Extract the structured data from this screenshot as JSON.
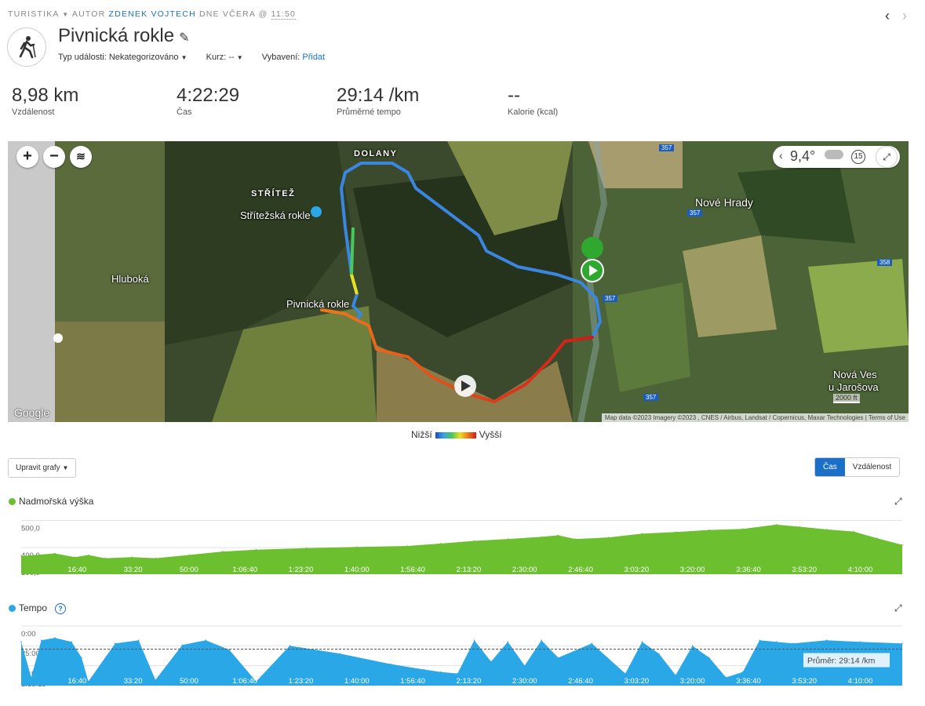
{
  "header": {
    "category": "TURISTIKA",
    "dropdown_glyph": "▼",
    "author_prefix": "AUTOR",
    "author": "ZDENEK VOJTECH",
    "date_prefix": "DNE VČERA @",
    "time": "11:50",
    "prev_arrow": "‹",
    "next_arrow": "›"
  },
  "activity": {
    "icon": "hiker-icon",
    "title": "Pivnická rokle",
    "edit_icon": "pencil-icon",
    "event_type_label": "Typ události:",
    "event_type_value": "Nekategorizováno",
    "course_label": "Kurz:",
    "course_value": "--",
    "gear_label": "Vybavení:",
    "gear_link": "Přidat"
  },
  "stats": [
    {
      "value": "8,98 km",
      "label": "Vzdálenost"
    },
    {
      "value": "4:22:29",
      "label": "Čas"
    },
    {
      "value": "29:14 /km",
      "label": "Průměrné tempo"
    },
    {
      "value": "--",
      "label": "Kalorie (kcal)"
    }
  ],
  "map": {
    "zoom_in": "+",
    "zoom_out": "−",
    "temperature": "9,4°",
    "wind_value": "15",
    "places": {
      "dolany": "DOLANY",
      "stritez": "STŘÍTEŽ",
      "stritezska": "Střítežská rokle",
      "nove_hrady": "Nové Hrady",
      "hluboka": "Hluboká",
      "pivnicka": "Pivnická rokle",
      "nova_ves": "Nová Ves",
      "nova_ves2": "u Jarošova"
    },
    "road_numbers": [
      "357",
      "357",
      "358",
      "357",
      "357"
    ],
    "scale": "2000 ft",
    "google": "Google",
    "attribution": "Map data ©2023 Imagery ©2023 , CNES / Airbus, Landsat / Copernicus, Maxar Technologies",
    "terms": "Terms of Use",
    "legend_low": "Nižší",
    "legend_high": "Vyšší",
    "colors": {
      "low": "#2446c8",
      "high": "#d01a1a",
      "start_marker": "#2fa82f"
    }
  },
  "controls": {
    "edit_charts": "Upravit grafy",
    "toggle_time": "Čas",
    "toggle_distance": "Vzdálenost",
    "toggle_active": "Čas"
  },
  "chart_data": [
    {
      "type": "area",
      "title": "Nadmořská výška",
      "color": "#6cbf2e",
      "y_ticks": [
        "500,0",
        "400,0",
        "300,0"
      ],
      "ylim": [
        300,
        500
      ],
      "x_ticks": [
        "16:40",
        "33:20",
        "50:00",
        "1:06:40",
        "1:23:20",
        "1:40:00",
        "1:56:40",
        "2:13:20",
        "2:30:00",
        "2:46:40",
        "3:03:20",
        "3:20:00",
        "3:36:40",
        "3:53:20",
        "4:10:00"
      ],
      "x_minutes": [
        0,
        10,
        16,
        20,
        25,
        33,
        40,
        50,
        60,
        70,
        85,
        100,
        115,
        125,
        135,
        145,
        155,
        160,
        165,
        175,
        185,
        195,
        205,
        215,
        225,
        232,
        240,
        248,
        255,
        262.5
      ],
      "values": [
        368,
        378,
        364,
        372,
        360,
        364,
        360,
        372,
        385,
        392,
        398,
        402,
        406,
        415,
        425,
        432,
        440,
        446,
        432,
        438,
        452,
        458,
        466,
        470,
        486,
        478,
        468,
        460,
        435,
        410
      ]
    },
    {
      "type": "area",
      "title": "Tempo",
      "color": "#2aa7e6",
      "y_ticks": [
        "0:00",
        "25:00",
        "50:00",
        "1:15:15"
      ],
      "ylim_minutes_per_km": [
        0,
        75.25
      ],
      "inverted": true,
      "average_label": "Průměr: 29:14 /km",
      "average_minutes_per_km": 29.23,
      "x_ticks": [
        "16:40",
        "33:20",
        "50:00",
        "1:06:40",
        "1:23:20",
        "1:40:00",
        "1:56:40",
        "2:13:20",
        "2:30:00",
        "2:46:40",
        "3:03:20",
        "3:20:00",
        "3:36:40",
        "3:53:20",
        "4:10:00"
      ],
      "x_minutes": [
        0,
        3,
        6,
        10,
        15,
        18,
        20,
        28,
        35,
        40,
        48,
        55,
        62,
        70,
        80,
        95,
        110,
        120,
        125,
        130,
        135,
        140,
        145,
        150,
        155,
        160,
        170,
        180,
        185,
        190,
        195,
        200,
        205,
        210,
        215,
        220,
        225,
        230,
        240,
        250,
        262.5
      ],
      "values": [
        20,
        65,
        18,
        15,
        20,
        40,
        70,
        22,
        18,
        68,
        24,
        18,
        30,
        70,
        25,
        35,
        48,
        55,
        58,
        60,
        18,
        45,
        20,
        50,
        18,
        40,
        22,
        60,
        20,
        35,
        62,
        25,
        40,
        65,
        58,
        18,
        20,
        22,
        18,
        20,
        22
      ]
    }
  ]
}
